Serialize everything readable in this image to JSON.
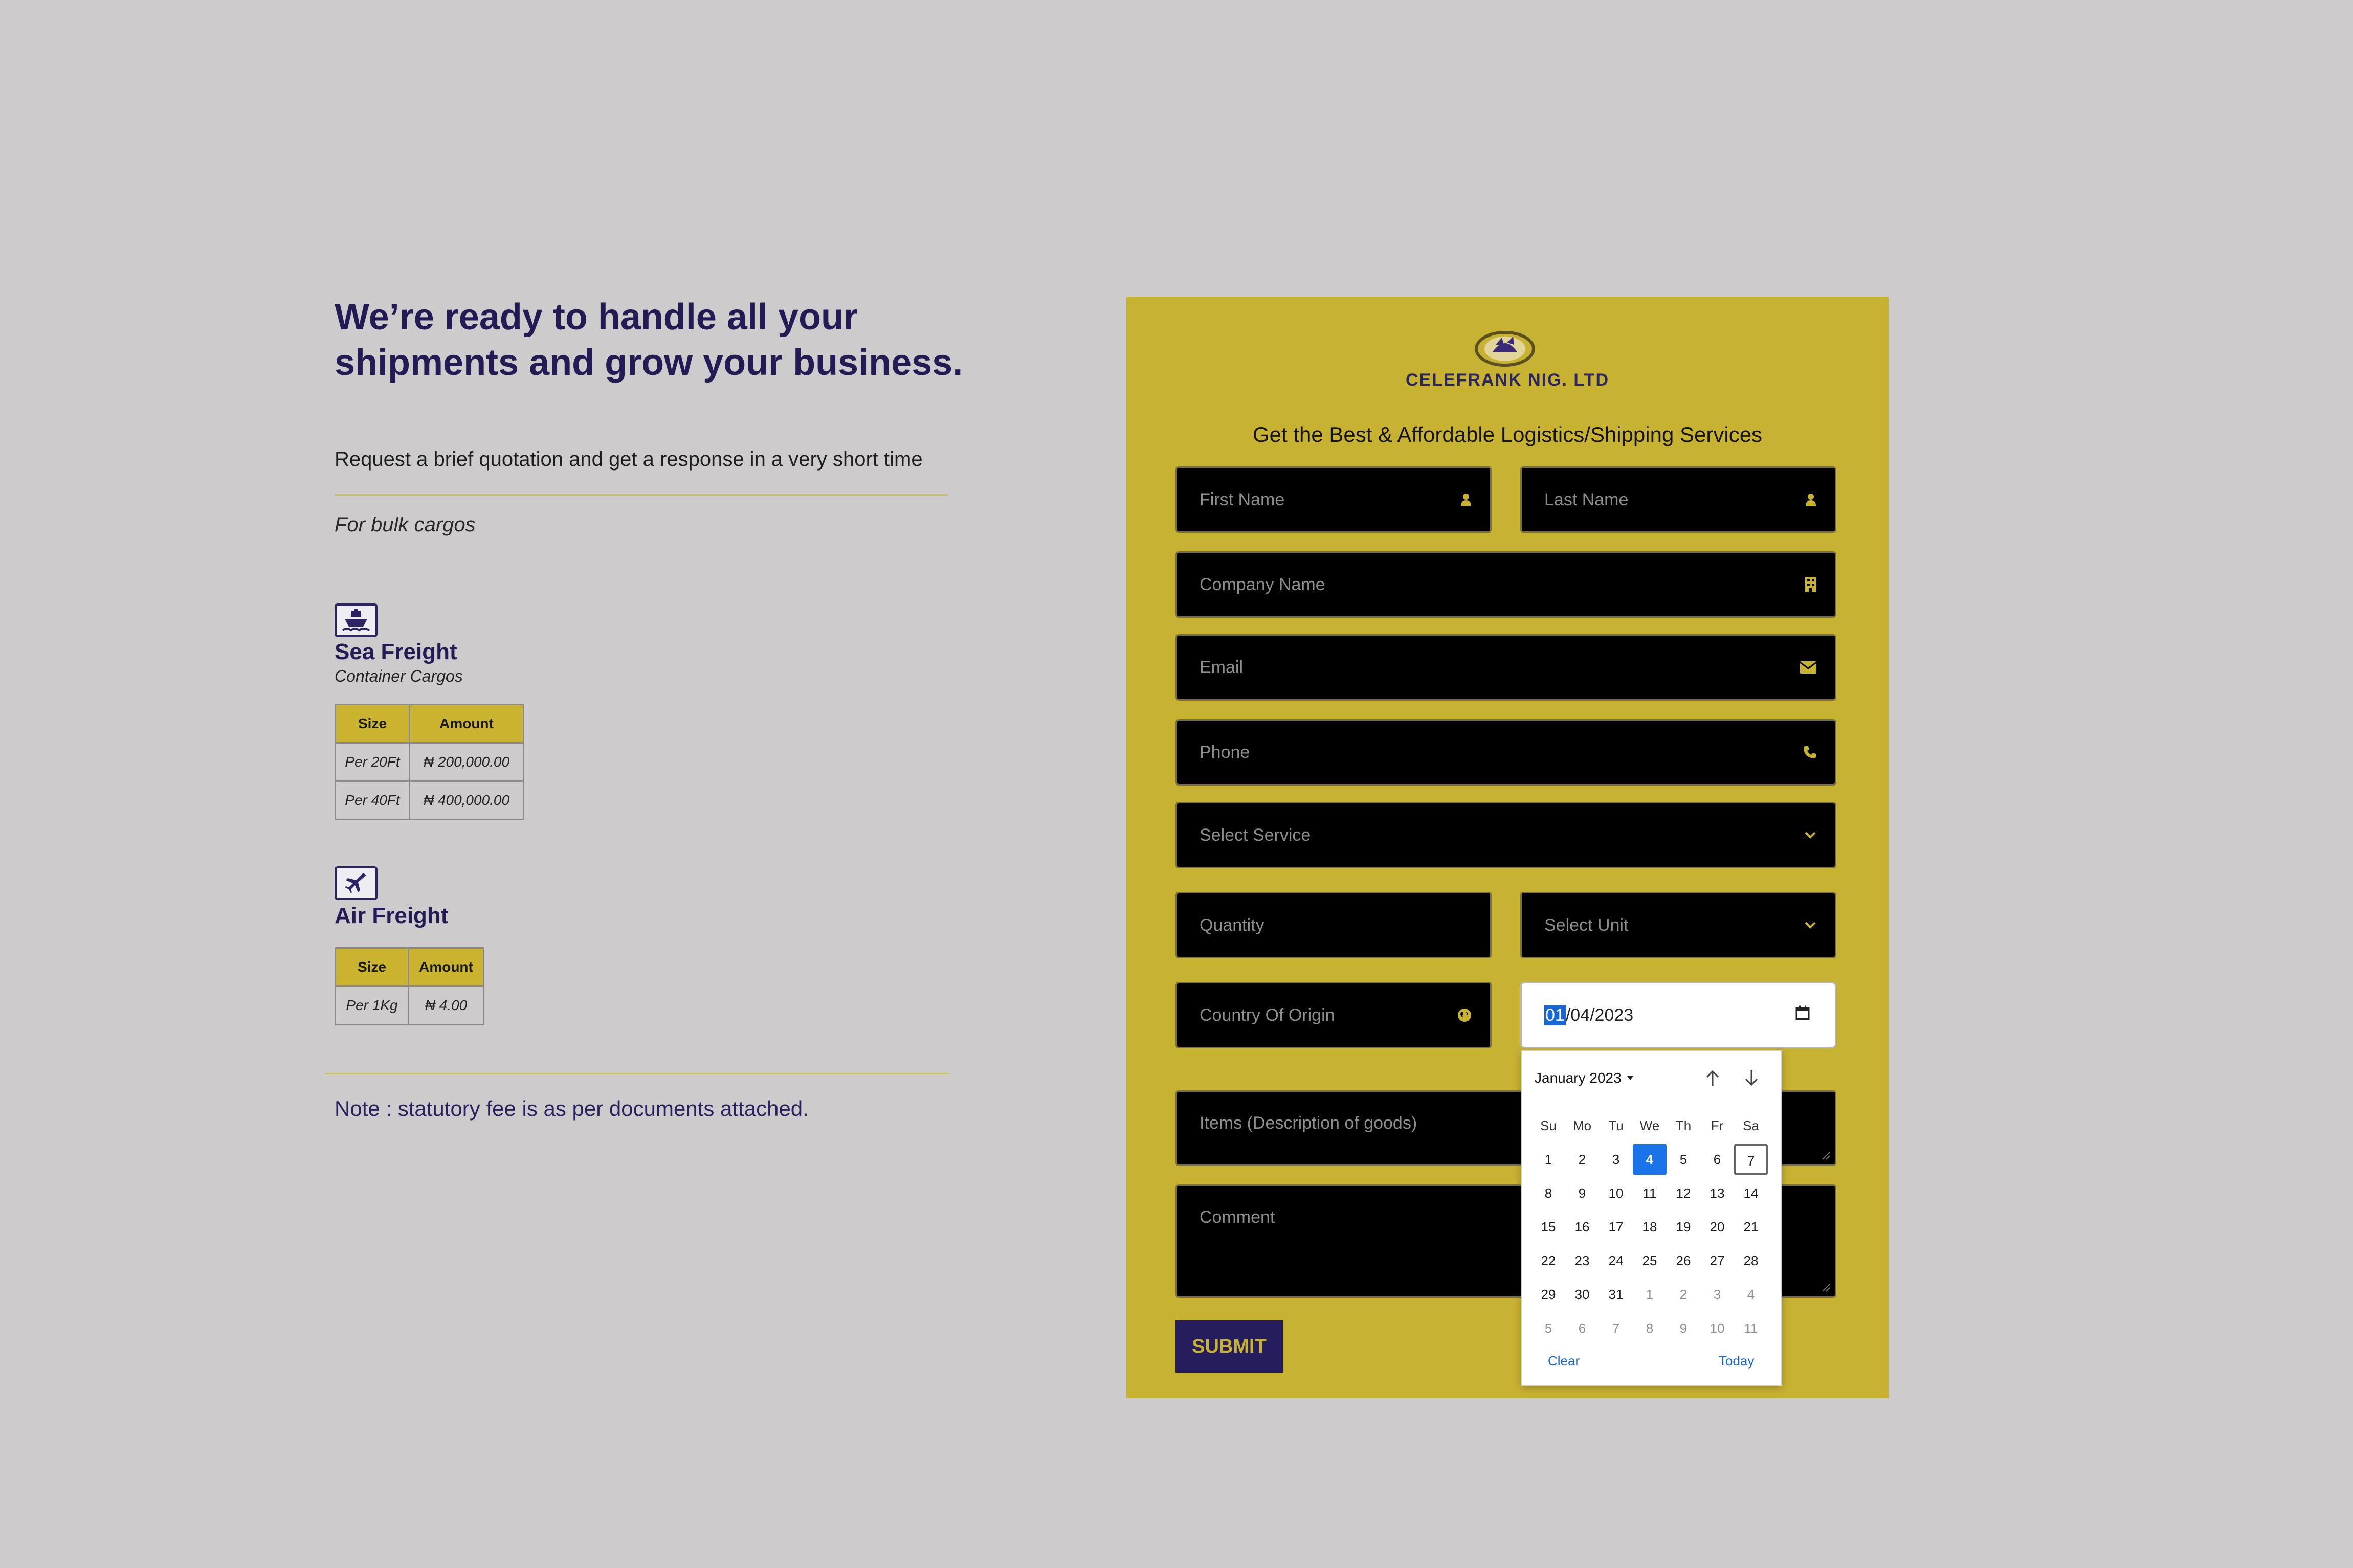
{
  "hero": {
    "headline": "We’re ready to handle all your shipments and grow your business.",
    "subline": "Request a brief quotation and get a response in a very short time",
    "bulk_label": "For bulk cargos"
  },
  "sea": {
    "title": "Sea Freight",
    "subtitle": "Container Cargos",
    "headers": [
      "Size",
      "Amount"
    ],
    "rows": [
      [
        "Per 20Ft",
        "₦ 200,000.00"
      ],
      [
        "Per 40Ft",
        "₦ 400,000.00"
      ]
    ]
  },
  "air": {
    "title": "Air Freight",
    "headers": [
      "Size",
      "Amount"
    ],
    "rows": [
      [
        "Per 1Kg",
        "₦ 4.00"
      ]
    ]
  },
  "note": "Note : statutory fee is as per documents attached.",
  "form": {
    "brand": "CELEFRANK NIG. LTD",
    "tagline": "Get the Best & Affordable Logistics/Shipping Services",
    "first_name_ph": "First Name",
    "last_name_ph": "Last Name",
    "company_ph": "Company Name",
    "email_ph": "Email",
    "phone_ph": "Phone",
    "service_ph": "Select Service",
    "quantity_ph": "Quantity",
    "unit_ph": "Select Unit",
    "country_ph": "Country Of Origin",
    "date_value": {
      "month_sel": "01",
      "rest": "/04/2023"
    },
    "items_ph": "Items (Description of goods)",
    "comment_ph": "Comment",
    "submit_label": "SUBMIT"
  },
  "calendar": {
    "month_label": "January 2023",
    "days_of_week": [
      "Su",
      "Mo",
      "Tu",
      "We",
      "Th",
      "Fr",
      "Sa"
    ],
    "weeks": [
      [
        [
          "1",
          0
        ],
        [
          "2",
          0
        ],
        [
          "3",
          0
        ],
        [
          "4",
          0
        ],
        [
          "5",
          0
        ],
        [
          "6",
          0
        ],
        [
          "7",
          0
        ]
      ],
      [
        [
          "8",
          0
        ],
        [
          "9",
          0
        ],
        [
          "10",
          0
        ],
        [
          "11",
          0
        ],
        [
          "12",
          0
        ],
        [
          "13",
          0
        ],
        [
          "14",
          0
        ]
      ],
      [
        [
          "15",
          0
        ],
        [
          "16",
          0
        ],
        [
          "17",
          0
        ],
        [
          "18",
          0
        ],
        [
          "19",
          0
        ],
        [
          "20",
          0
        ],
        [
          "21",
          0
        ]
      ],
      [
        [
          "22",
          0
        ],
        [
          "23",
          0
        ],
        [
          "24",
          0
        ],
        [
          "25",
          0
        ],
        [
          "26",
          0
        ],
        [
          "27",
          0
        ],
        [
          "28",
          0
        ]
      ],
      [
        [
          "29",
          0
        ],
        [
          "30",
          0
        ],
        [
          "31",
          0
        ],
        [
          "1",
          1
        ],
        [
          "2",
          1
        ],
        [
          "3",
          1
        ],
        [
          "4",
          1
        ]
      ],
      [
        [
          "5",
          1
        ],
        [
          "6",
          1
        ],
        [
          "7",
          1
        ],
        [
          "8",
          1
        ],
        [
          "9",
          1
        ],
        [
          "10",
          1
        ],
        [
          "11",
          1
        ]
      ]
    ],
    "selected_day": "4",
    "today_day": "7",
    "clear_label": "Clear",
    "today_label": "Today"
  },
  "colors": {
    "background": "#cdcbcb",
    "panel": "#c8b232",
    "navy": "#261d5c",
    "field": "#000000",
    "accent_blue": "#1a73e8"
  }
}
